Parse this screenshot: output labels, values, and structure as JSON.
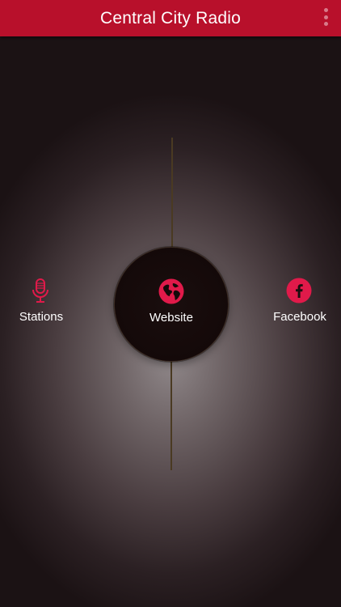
{
  "appbar": {
    "title": "Central City Radio",
    "menu_icon": "overflow-menu-icon"
  },
  "actions": {
    "stations": {
      "label": "Stations",
      "icon": "microphone-icon"
    },
    "website": {
      "label": "Website",
      "icon": "globe-icon"
    },
    "facebook": {
      "label": "Facebook",
      "icon": "facebook-icon"
    }
  },
  "colors": {
    "accent": "#b8102b",
    "icon_red": "#e01a4a",
    "needle": "#4a3a22",
    "text": "#ffffff"
  }
}
